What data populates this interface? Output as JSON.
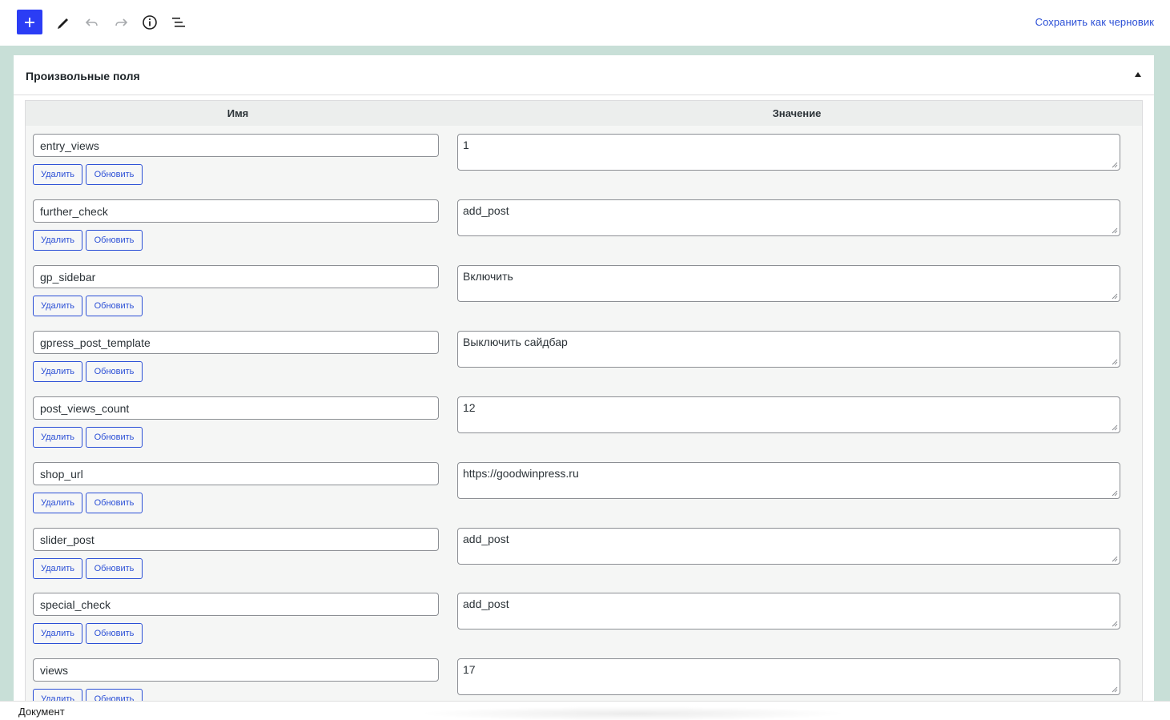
{
  "toolbar": {
    "icons": [
      "plus-icon",
      "pencil-icon",
      "undo-icon",
      "redo-icon",
      "info-icon",
      "list-view-icon"
    ],
    "save_draft": "Сохранить как черновик",
    "accent": "#2b3df5"
  },
  "panel": {
    "title": "Произвольные поля"
  },
  "fields": {
    "col_name": "Имя",
    "col_value": "Значение",
    "delete_label": "Удалить",
    "update_label": "Обновить",
    "rows": [
      {
        "name": "entry_views",
        "value": "1"
      },
      {
        "name": "further_check",
        "value": "add_post"
      },
      {
        "name": "gp_sidebar",
        "value": "Включить"
      },
      {
        "name": "gpress_post_template",
        "value": "Выключить сайдбар"
      },
      {
        "name": "post_views_count",
        "value": "12"
      },
      {
        "name": "shop_url",
        "value": "https://goodwinpress.ru"
      },
      {
        "name": "slider_post",
        "value": "add_post"
      },
      {
        "name": "special_check",
        "value": "add_post"
      },
      {
        "name": "views",
        "value": "17"
      }
    ]
  },
  "footer": {
    "breadcrumb": "Документ"
  }
}
